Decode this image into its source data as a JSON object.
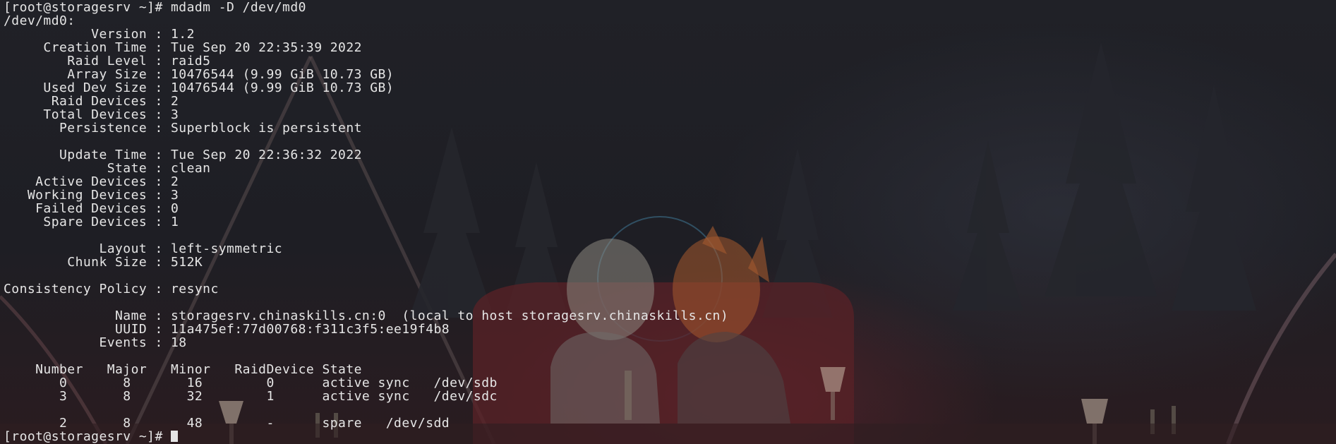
{
  "colors": {
    "background": "#1c1d22",
    "foreground": "#e6e6e6"
  },
  "terminal": {
    "lines": [
      "[root@storagesrv ~]# mdadm -D /dev/md0",
      "/dev/md0:",
      "           Version : 1.2",
      "     Creation Time : Tue Sep 20 22:35:39 2022",
      "        Raid Level : raid5",
      "        Array Size : 10476544 (9.99 GiB 10.73 GB)",
      "     Used Dev Size : 10476544 (9.99 GiB 10.73 GB)",
      "      Raid Devices : 2",
      "     Total Devices : 3",
      "       Persistence : Superblock is persistent",
      "",
      "       Update Time : Tue Sep 20 22:36:32 2022",
      "             State : clean",
      "    Active Devices : 2",
      "   Working Devices : 3",
      "    Failed Devices : 0",
      "     Spare Devices : 1",
      "",
      "            Layout : left-symmetric",
      "        Chunk Size : 512K",
      "",
      "Consistency Policy : resync",
      "",
      "              Name : storagesrv.chinaskills.cn:0  (local to host storagesrv.chinaskills.cn)",
      "              UUID : 11a475ef:77d00768:f311c3f5:ee19f4b8",
      "            Events : 18",
      "",
      "    Number   Major   Minor   RaidDevice State",
      "       0       8       16        0      active sync   /dev/sdb",
      "       3       8       32        1      active sync   /dev/sdc",
      "",
      "       2       8       48        -      spare   /dev/sdd"
    ],
    "prompt": "[root@storagesrv ~]# "
  }
}
